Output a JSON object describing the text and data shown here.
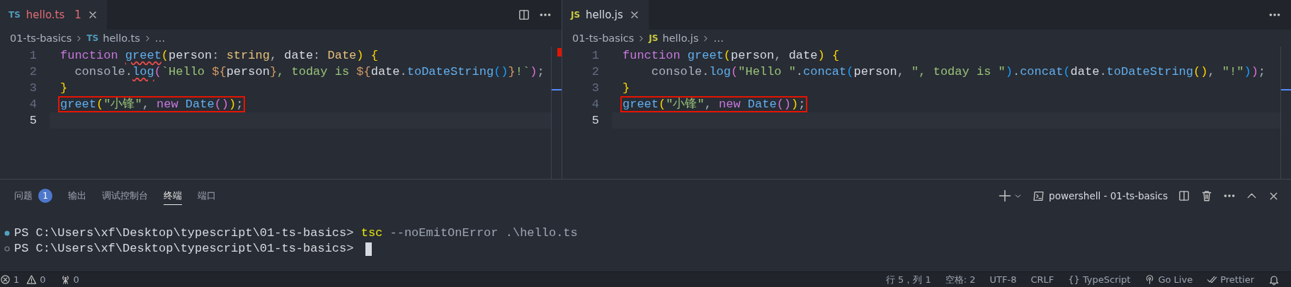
{
  "editors": [
    {
      "tabs": [
        {
          "icon_label": "TS",
          "color": "#519aba",
          "label": "hello.ts",
          "problems": "1",
          "error": true,
          "selected": true
        }
      ],
      "actions": [
        {
          "kind": "split"
        },
        {
          "kind": "more"
        }
      ],
      "breadcrumbs": [
        {
          "text": "01-ts-basics"
        },
        {
          "icon_label": "TS",
          "color": "#519aba",
          "text": "hello.ts"
        },
        {
          "text": "…"
        }
      ],
      "lines": [
        {
          "number": "1",
          "highlighted": false,
          "current": false,
          "tokens": [
            {
              "kind": "keyword",
              "text": "function "
            },
            {
              "kind": "function-error",
              "text": "greet"
            },
            {
              "kind": "bracket1",
              "text": "("
            },
            {
              "kind": "param",
              "text": "person"
            },
            {
              "kind": "plain",
              "text": ": "
            },
            {
              "kind": "type",
              "text": "string"
            },
            {
              "kind": "plain",
              "text": ", "
            },
            {
              "kind": "param",
              "text": "date"
            },
            {
              "kind": "plain",
              "text": ": "
            },
            {
              "kind": "type",
              "text": "Date"
            },
            {
              "kind": "bracket1",
              "text": ") {"
            }
          ]
        },
        {
          "number": "2",
          "highlighted": false,
          "current": false,
          "tokens": [
            {
              "kind": "plain",
              "text": "  console."
            },
            {
              "kind": "function-error",
              "text": "log"
            },
            {
              "kind": "bracket2",
              "text": "("
            },
            {
              "kind": "string",
              "text": "`Hello "
            },
            {
              "kind": "template",
              "text": "${"
            },
            {
              "kind": "param",
              "text": "person"
            },
            {
              "kind": "template",
              "text": "}"
            },
            {
              "kind": "string",
              "text": ", today is "
            },
            {
              "kind": "template",
              "text": "${"
            },
            {
              "kind": "param",
              "text": "date"
            },
            {
              "kind": "plain",
              "text": "."
            },
            {
              "kind": "function",
              "text": "toDateString"
            },
            {
              "kind": "bracket3",
              "text": "()"
            },
            {
              "kind": "template",
              "text": "}"
            },
            {
              "kind": "string",
              "text": "!`"
            },
            {
              "kind": "bracket2",
              "text": ")"
            },
            {
              "kind": "plain",
              "text": ";"
            }
          ]
        },
        {
          "number": "3",
          "highlighted": false,
          "current": false,
          "tokens": [
            {
              "kind": "bracket1",
              "text": "}"
            }
          ]
        },
        {
          "number": "4",
          "highlighted": true,
          "current": false,
          "tokens": [
            {
              "kind": "function",
              "text": "greet"
            },
            {
              "kind": "bracket1",
              "text": "("
            },
            {
              "kind": "string",
              "text": "\"小锋\""
            },
            {
              "kind": "plain",
              "text": ", "
            },
            {
              "kind": "keyword",
              "text": "new "
            },
            {
              "kind": "function",
              "text": "Date"
            },
            {
              "kind": "bracket2",
              "text": "()"
            },
            {
              "kind": "bracket1",
              "text": ")"
            },
            {
              "kind": "plain",
              "text": ";"
            }
          ]
        },
        {
          "number": "5",
          "current": true
        }
      ]
    },
    {
      "tabs": [
        {
          "icon_label": "JS",
          "color": "#cbcb41",
          "label": "hello.js",
          "error": false,
          "selected": true
        }
      ],
      "actions": [
        {
          "kind": "more"
        }
      ],
      "breadcrumbs": [
        {
          "text": "01-ts-basics"
        },
        {
          "icon_label": "JS",
          "color": "#cbcb41",
          "text": "hello.js"
        },
        {
          "text": "…"
        }
      ],
      "lines": [
        {
          "number": "1",
          "highlighted": false,
          "current": false,
          "tokens": [
            {
              "kind": "keyword",
              "text": "function "
            },
            {
              "kind": "function",
              "text": "greet"
            },
            {
              "kind": "bracket1",
              "text": "("
            },
            {
              "kind": "param",
              "text": "person"
            },
            {
              "kind": "plain",
              "text": ", "
            },
            {
              "kind": "param",
              "text": "date"
            },
            {
              "kind": "bracket1",
              "text": ") {"
            }
          ]
        },
        {
          "number": "2",
          "highlighted": false,
          "current": false,
          "tokens": [
            {
              "kind": "plain",
              "text": "    console."
            },
            {
              "kind": "function",
              "text": "log"
            },
            {
              "kind": "bracket2",
              "text": "("
            },
            {
              "kind": "string",
              "text": "\"Hello \""
            },
            {
              "kind": "plain",
              "text": "."
            },
            {
              "kind": "function",
              "text": "concat"
            },
            {
              "kind": "bracket3",
              "text": "("
            },
            {
              "kind": "param",
              "text": "person"
            },
            {
              "kind": "plain",
              "text": ", "
            },
            {
              "kind": "string",
              "text": "\", today is \""
            },
            {
              "kind": "bracket3",
              "text": ")"
            },
            {
              "kind": "plain",
              "text": "."
            },
            {
              "kind": "function",
              "text": "concat"
            },
            {
              "kind": "bracket3",
              "text": "("
            },
            {
              "kind": "param",
              "text": "date"
            },
            {
              "kind": "plain",
              "text": "."
            },
            {
              "kind": "function",
              "text": "toDateString"
            },
            {
              "kind": "bracket1",
              "text": "()"
            },
            {
              "kind": "plain",
              "text": ", "
            },
            {
              "kind": "string",
              "text": "\"!\""
            },
            {
              "kind": "bracket3",
              "text": ")"
            },
            {
              "kind": "bracket2",
              "text": ")"
            },
            {
              "kind": "plain",
              "text": ";"
            }
          ]
        },
        {
          "number": "3",
          "highlighted": false,
          "current": false,
          "tokens": [
            {
              "kind": "bracket1",
              "text": "}"
            }
          ]
        },
        {
          "number": "4",
          "highlighted": true,
          "current": false,
          "tokens": [
            {
              "kind": "function",
              "text": "greet"
            },
            {
              "kind": "bracket1",
              "text": "("
            },
            {
              "kind": "string",
              "text": "\"小锋\""
            },
            {
              "kind": "plain",
              "text": ", "
            },
            {
              "kind": "keyword",
              "text": "new "
            },
            {
              "kind": "function",
              "text": "Date"
            },
            {
              "kind": "bracket2",
              "text": "()"
            },
            {
              "kind": "bracket1",
              "text": ")"
            },
            {
              "kind": "plain",
              "text": ";"
            }
          ]
        },
        {
          "number": "5",
          "current": true
        }
      ]
    }
  ],
  "panel": {
    "tabs": [
      {
        "label": "问题",
        "badge": "1",
        "selected": false
      },
      {
        "label": "输出",
        "selected": false
      },
      {
        "label": "调试控制台",
        "selected": false
      },
      {
        "label": "终端",
        "selected": true
      },
      {
        "label": "端口",
        "selected": false
      }
    ],
    "terminal_name": "powershell - 01-ts-basics",
    "terminal_lines": [
      {
        "kind": "success",
        "cursor": false,
        "segments": [
          {
            "kind": "prompt",
            "text": "PS C:\\Users\\xf\\Desktop\\typescript\\01-ts-basics> "
          },
          {
            "kind": "command",
            "text": "tsc"
          },
          {
            "kind": "args",
            "text": " --noEmitOnError .\\hello.ts"
          }
        ]
      },
      {
        "kind": "empty",
        "cursor": true,
        "segments": [
          {
            "kind": "prompt",
            "text": "PS C:\\Users\\xf\\Desktop\\typescript\\01-ts-basics> "
          }
        ]
      }
    ]
  },
  "status_bar": {
    "left": [
      {
        "kind": "errors",
        "text": "1"
      },
      {
        "kind": "warnings",
        "text": "0"
      },
      {
        "kind": "ports",
        "text": "0"
      }
    ],
    "right": [
      {
        "kind": "plain",
        "text": "行 5，列 1"
      },
      {
        "kind": "plain",
        "text": "空格: 2"
      },
      {
        "kind": "plain",
        "text": "UTF-8"
      },
      {
        "kind": "plain",
        "text": "CRLF"
      },
      {
        "kind": "language",
        "icon_text": "{}",
        "text": "TypeScript"
      },
      {
        "kind": "golive",
        "text": "Go Live"
      },
      {
        "kind": "prettier",
        "text": "Prettier"
      },
      {
        "kind": "bell"
      }
    ]
  }
}
